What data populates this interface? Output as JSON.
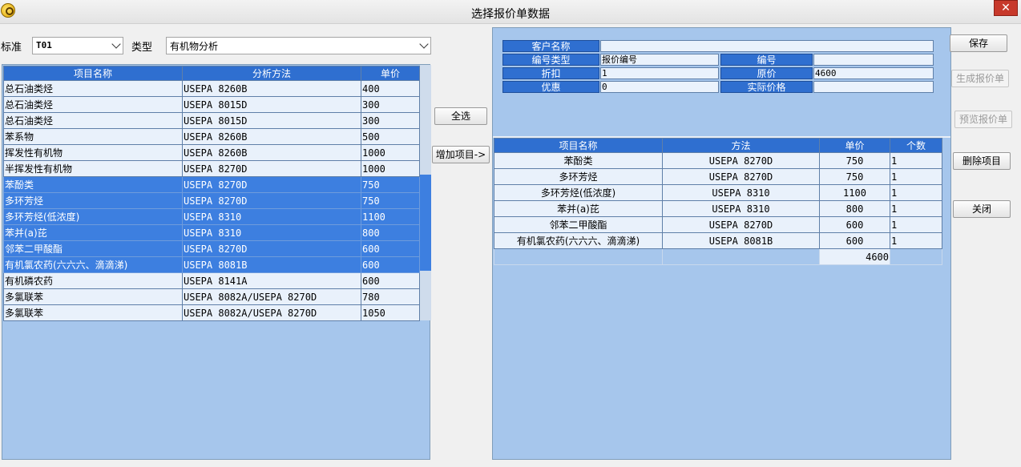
{
  "window": {
    "title": "选择报价单数据",
    "close_label": "✕"
  },
  "filters": {
    "standard_label": "标准",
    "standard_value": "T01",
    "type_label": "类型",
    "type_value": "有机物分析"
  },
  "left_grid": {
    "headers": [
      "项目名称",
      "分析方法",
      "单价"
    ],
    "rows": [
      {
        "name": "总石油类烃",
        "method": "USEPA 8260B",
        "price": "400"
      },
      {
        "name": "总石油类烃",
        "method": "USEPA 8015D",
        "price": "300"
      },
      {
        "name": "总石油类烃",
        "method": "USEPA 8015D",
        "price": "300"
      },
      {
        "name": "苯系物",
        "method": "USEPA 8260B",
        "price": "500"
      },
      {
        "name": "挥发性有机物",
        "method": "USEPA 8260B",
        "price": "1000"
      },
      {
        "name": "半挥发性有机物",
        "method": "USEPA 8270D",
        "price": "1000"
      },
      {
        "name": "苯酚类",
        "method": "USEPA 8270D",
        "price": "750"
      },
      {
        "name": "多环芳烃",
        "method": "USEPA 8270D",
        "price": "750"
      },
      {
        "name": "多环芳烃(低浓度)",
        "method": "USEPA 8310",
        "price": "1100"
      },
      {
        "name": "苯并(a)芘",
        "method": "USEPA 8310",
        "price": "800"
      },
      {
        "name": "邻苯二甲酸酯",
        "method": "USEPA 8270D",
        "price": "600"
      },
      {
        "name": "有机氯农药(六六六、滴滴涕)",
        "method": "USEPA 8081B",
        "price": "600"
      },
      {
        "name": "有机磷农药",
        "method": "USEPA 8141A",
        "price": "600"
      },
      {
        "name": "多氯联苯",
        "method": "USEPA 8082A/USEPA 8270D",
        "price": "780"
      },
      {
        "name": "多氯联苯",
        "method": "USEPA 8082A/USEPA 8270D",
        "price": "1050"
      }
    ]
  },
  "middle_buttons": {
    "select_all": "全选",
    "add_items": "增加项目->"
  },
  "form": {
    "customer_label": "客户名称",
    "customer_value": "",
    "number_type_label": "编号类型",
    "number_type_value": "报价编号",
    "number_label": "编号",
    "number_value": "",
    "discount_label": "折扣",
    "discount_value": "1",
    "original_price_label": "原价",
    "original_price_value": "4600",
    "promotion_label": "优惠",
    "promotion_value": "0",
    "actual_price_label": "实际价格",
    "actual_price_value": ""
  },
  "right_grid": {
    "headers": [
      "项目名称",
      "方法",
      "单价",
      "个数"
    ],
    "rows": [
      {
        "name": "苯酚类",
        "method": "USEPA 8270D",
        "price": "750",
        "count": "1"
      },
      {
        "name": "多环芳烃",
        "method": "USEPA 8270D",
        "price": "750",
        "count": "1"
      },
      {
        "name": "多环芳烃(低浓度)",
        "method": "USEPA 8310",
        "price": "1100",
        "count": "1"
      },
      {
        "name": "苯并(a)芘",
        "method": "USEPA 8310",
        "price": "800",
        "count": "1"
      },
      {
        "name": "邻苯二甲酸酯",
        "method": "USEPA 8270D",
        "price": "600",
        "count": "1"
      },
      {
        "name": "有机氯农药(六六六、滴滴涕)",
        "method": "USEPA 8081B",
        "price": "600",
        "count": "1"
      }
    ],
    "total": "4600"
  },
  "side_buttons": {
    "save": "保存",
    "generate": "生成报价单",
    "preview": "预览报价单",
    "delete_item": "删除项目",
    "close": "关闭"
  }
}
